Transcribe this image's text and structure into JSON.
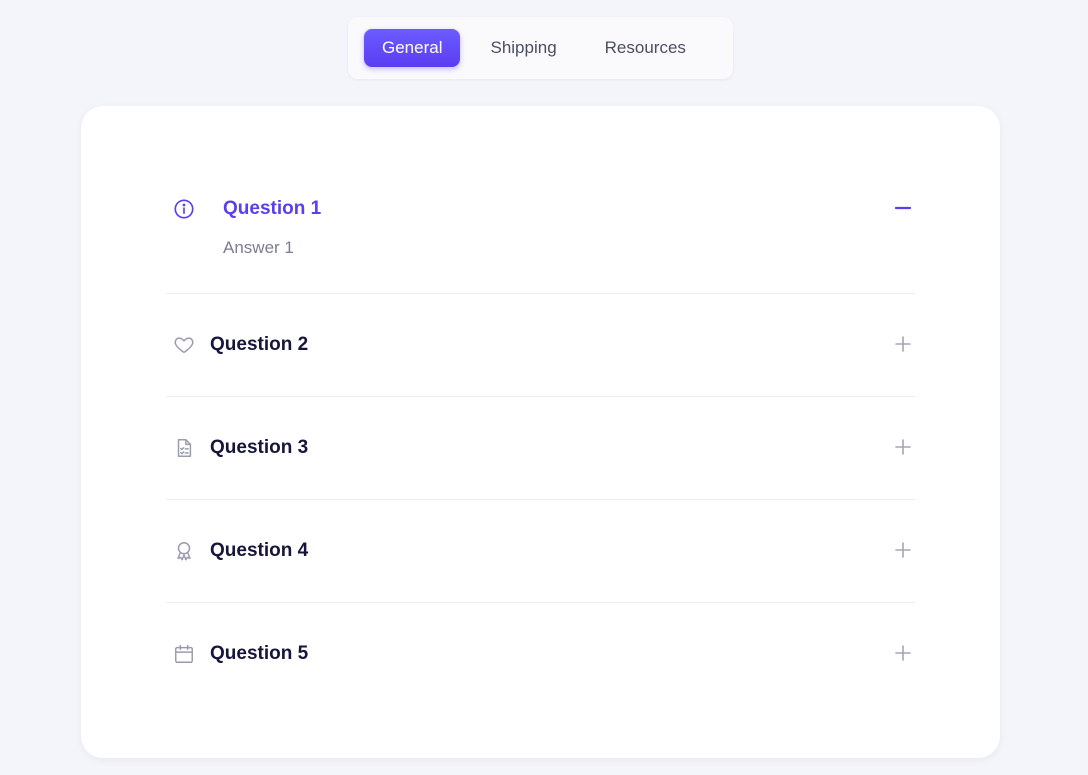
{
  "tabs": [
    {
      "label": "General",
      "active": true
    },
    {
      "label": "Shipping",
      "active": false
    },
    {
      "label": "Resources",
      "active": false
    }
  ],
  "faq": {
    "items": [
      {
        "question": "Question 1",
        "answer": "Answer 1",
        "icon": "info-icon",
        "expanded": true
      },
      {
        "question": "Question 2",
        "icon": "heart-icon",
        "expanded": false
      },
      {
        "question": "Question 3",
        "icon": "checklist-document-icon",
        "expanded": false
      },
      {
        "question": "Question 4",
        "icon": "award-ribbon-icon",
        "expanded": false
      },
      {
        "question": "Question 5",
        "icon": "calendar-icon",
        "expanded": false
      }
    ]
  },
  "colors": {
    "accent": "#5b3df2",
    "page_background": "#f4f5fa",
    "card_background": "#ffffff",
    "title_text": "#16163a",
    "muted_text": "#7b7d91",
    "icon_gray": "#9a9cae"
  }
}
